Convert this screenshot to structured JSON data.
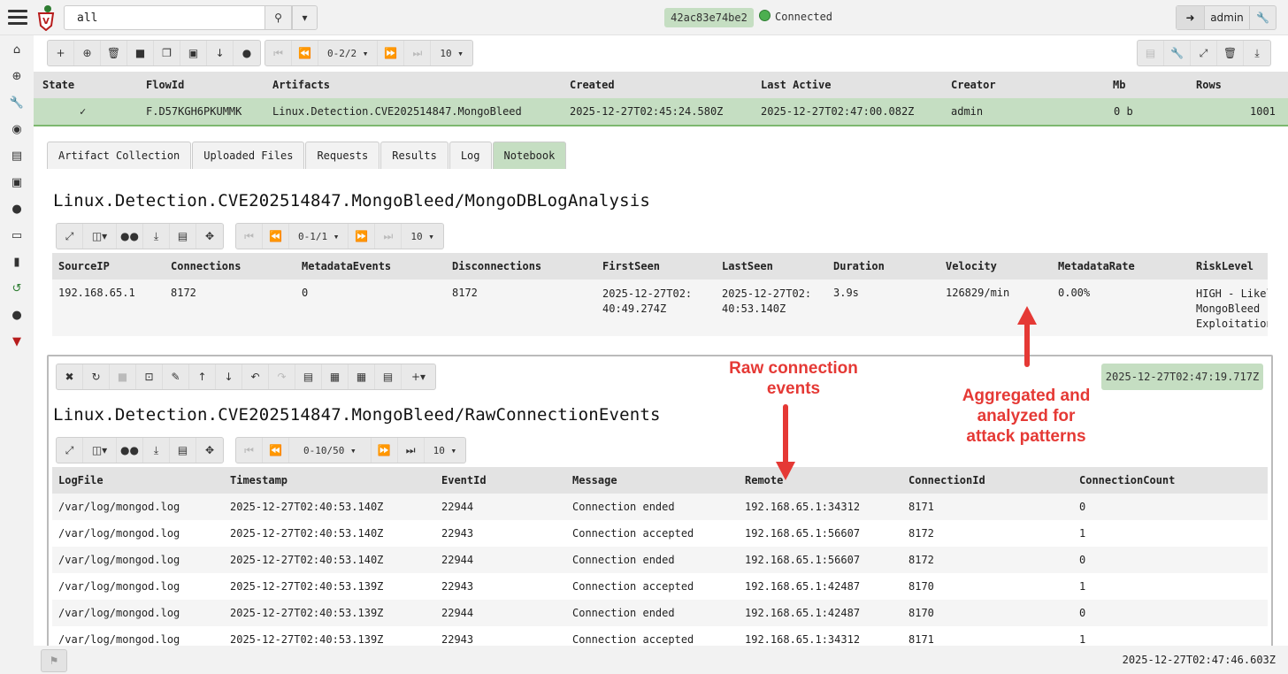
{
  "search": {
    "value": "all"
  },
  "top": {
    "hash": "42ac83e74be2",
    "status": "Connected",
    "user": "admin"
  },
  "flow_toolbar": {
    "pager": "0-2/2",
    "page_size": "10"
  },
  "flows": {
    "columns": [
      "State",
      "FlowId",
      "Artifacts",
      "Created",
      "Last Active",
      "Creator",
      "Mb",
      "Rows"
    ],
    "rows": [
      {
        "state": "✓",
        "flow_id": "F.D57KGH6PKUMMK",
        "artifacts": "Linux.Detection.CVE202514847.MongoBleed",
        "created": "2025-12-27T02:45:24.580Z",
        "last_active": "2025-12-27T02:47:00.082Z",
        "creator": "admin",
        "mb": "0 b",
        "rows": "1001"
      }
    ]
  },
  "tabs": [
    "Artifact Collection",
    "Uploaded Files",
    "Requests",
    "Results",
    "Log",
    "Notebook"
  ],
  "section1": {
    "title": "Linux.Detection.CVE202514847.MongoBleed/MongoDBLogAnalysis",
    "pager": "0-1/1",
    "page_size": "10",
    "columns": [
      "SourceIP",
      "Connections",
      "MetadataEvents",
      "Disconnections",
      "FirstSeen",
      "LastSeen",
      "Duration",
      "Velocity",
      "MetadataRate",
      "RiskLevel"
    ],
    "row": {
      "source_ip": "192.168.65.1",
      "connections": "8172",
      "metadata_events": "0",
      "disconnections": "8172",
      "first_seen": "2025-12-27T02:40:49.274Z",
      "last_seen": "2025-12-27T02:40:53.140Z",
      "duration": "3.9s",
      "velocity": "126829/min",
      "metadata_rate": "0.00%",
      "risk_level": "HIGH - Likely MongoBleed Exploitation"
    }
  },
  "cell": {
    "timestamp": "2025-12-27T02:47:19.717Z"
  },
  "section2": {
    "title": "Linux.Detection.CVE202514847.MongoBleed/RawConnectionEvents",
    "pager": "0-10/50",
    "page_size": "10",
    "columns": [
      "LogFile",
      "Timestamp",
      "EventId",
      "Message",
      "Remote",
      "ConnectionId",
      "ConnectionCount"
    ],
    "rows": [
      {
        "log": "/var/log/mongod.log",
        "ts": "2025-12-27T02:40:53.140Z",
        "eid": "22944",
        "msg": "Connection ended",
        "remote": "192.168.65.1:34312",
        "cid": "8171",
        "cnt": "0"
      },
      {
        "log": "/var/log/mongod.log",
        "ts": "2025-12-27T02:40:53.140Z",
        "eid": "22943",
        "msg": "Connection accepted",
        "remote": "192.168.65.1:56607",
        "cid": "8172",
        "cnt": "1"
      },
      {
        "log": "/var/log/mongod.log",
        "ts": "2025-12-27T02:40:53.140Z",
        "eid": "22944",
        "msg": "Connection ended",
        "remote": "192.168.65.1:56607",
        "cid": "8172",
        "cnt": "0"
      },
      {
        "log": "/var/log/mongod.log",
        "ts": "2025-12-27T02:40:53.139Z",
        "eid": "22943",
        "msg": "Connection accepted",
        "remote": "192.168.65.1:42487",
        "cid": "8170",
        "cnt": "1"
      },
      {
        "log": "/var/log/mongod.log",
        "ts": "2025-12-27T02:40:53.139Z",
        "eid": "22944",
        "msg": "Connection ended",
        "remote": "192.168.65.1:42487",
        "cid": "8170",
        "cnt": "0"
      },
      {
        "log": "/var/log/mongod.log",
        "ts": "2025-12-27T02:40:53.139Z",
        "eid": "22943",
        "msg": "Connection accepted",
        "remote": "192.168.65.1:34312",
        "cid": "8171",
        "cnt": "1"
      }
    ]
  },
  "annotations": {
    "raw": "Raw connection events",
    "agg": "Aggregated and analyzed for attack patterns"
  },
  "footer": {
    "time": "2025-12-27T02:47:46.603Z"
  },
  "colors": {
    "accent_green": "#c5dec2",
    "annotation_red": "#e53935",
    "header_gray": "#e3e3e3"
  }
}
